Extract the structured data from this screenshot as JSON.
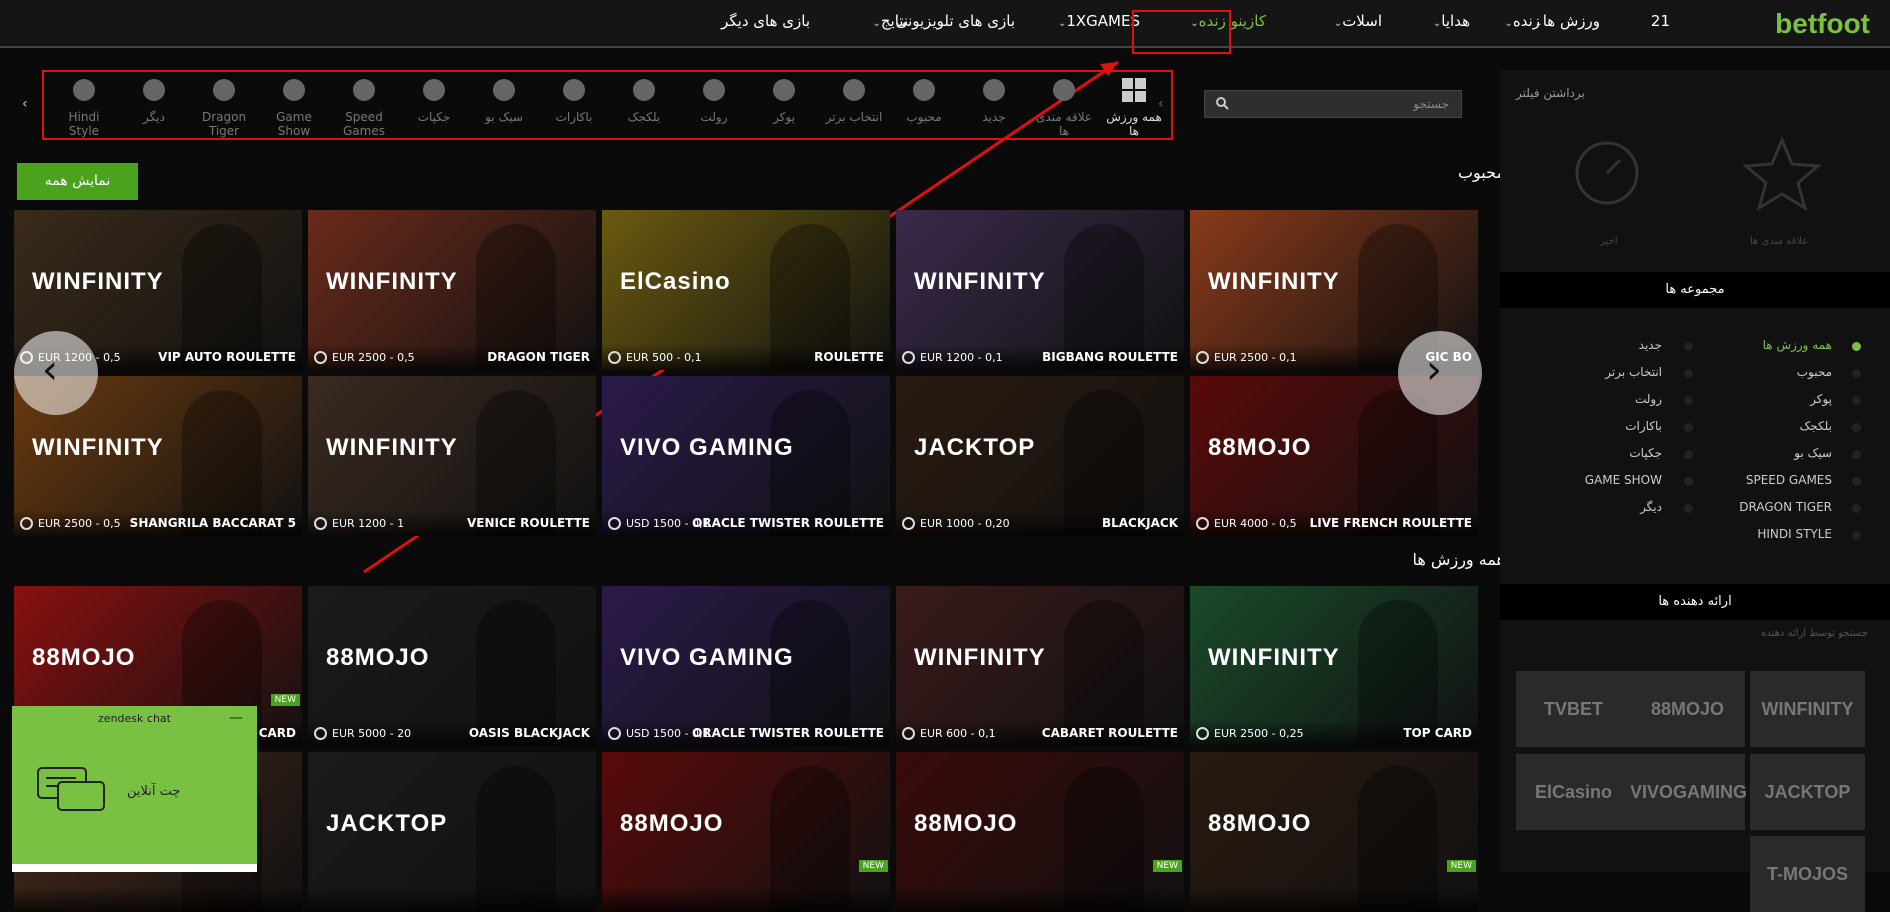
{
  "brand": {
    "logo": "betfoot",
    "logo_color": "#7cc043",
    "accent": "#4aa21d",
    "annotation_color": "#e01010"
  },
  "nav": {
    "items": [
      {
        "label": "21",
        "icon": "dice-21-icon"
      },
      {
        "label": "ورزش ها",
        "dropdown": true
      },
      {
        "label": "زنده",
        "dropdown": true
      },
      {
        "label": "هدایا",
        "dropdown": true
      },
      {
        "label": "اسلات",
        "dropdown": true
      },
      {
        "label": "کازینو زنده",
        "dropdown": true,
        "active": true
      },
      {
        "label": "1XGAMES",
        "dropdown": true
      },
      {
        "label": "بازی های تلویزیونی",
        "dropdown": false
      },
      {
        "label": "نتایج",
        "dropdown": true
      },
      {
        "label": "بازی های دیگر",
        "dropdown": false
      }
    ]
  },
  "categories": [
    {
      "label": "همه ورزش ها",
      "icon": "grid-icon",
      "active": true
    },
    {
      "label": "علاقه مندی ها",
      "icon": "star-icon"
    },
    {
      "label": "جدید",
      "icon": "new-badge-icon"
    },
    {
      "label": "محبوب",
      "icon": "flame-icon"
    },
    {
      "label": "انتخاب برتر",
      "icon": "top-choice-icon"
    },
    {
      "label": "پوکر",
      "icon": "poker-icon"
    },
    {
      "label": "رولت",
      "icon": "roulette-icon"
    },
    {
      "label": "بلکجک",
      "icon": "blackjack-icon"
    },
    {
      "label": "باکارات",
      "icon": "baccarat-icon"
    },
    {
      "label": "سیک بو",
      "icon": "dice-icon"
    },
    {
      "label": "جکپات",
      "icon": "moneybag-icon"
    },
    {
      "label": "Speed Games",
      "icon": "speedometer-icon"
    },
    {
      "label": "Game Show",
      "icon": "wheel-icon"
    },
    {
      "label": "Dragon Tiger",
      "icon": "dragon-icon"
    },
    {
      "label": "دیگر",
      "icon": "chips-icon"
    },
    {
      "label": "Hindi Style",
      "icon": "lotus-icon"
    }
  ],
  "search": {
    "placeholder": "جستجو"
  },
  "popular": {
    "title": "محبوب",
    "show_all": "نمایش همه",
    "games": [
      {
        "name": "GIC BO",
        "limit": "EUR 2500 - 0,1",
        "brand": "WINFINITY",
        "color": "#8a3a1a"
      },
      {
        "name": "BIGBANG ROULETTE",
        "limit": "EUR 1200 - 0,1",
        "brand": "WINFINITY",
        "color": "#3a2a4a"
      },
      {
        "name": "ROULETTE",
        "limit": "EUR 500 - 0,1",
        "brand": "ElCasino",
        "color": "#6a5a10"
      },
      {
        "name": "DRAGON TIGER",
        "limit": "EUR 2500 - 0,5",
        "brand": "WINFINITY",
        "color": "#6a2a1a"
      },
      {
        "name": "VIP AUTO ROULETTE",
        "limit": "EUR 1200 - 0,5",
        "brand": "WINFINITY",
        "color": "#3a2a1a"
      },
      {
        "name": "LIVE FRENCH ROULETTE",
        "limit": "EUR 4000 - 0,5",
        "brand": "88MOJO",
        "color": "#5a0a0a"
      },
      {
        "name": "BLACKJACK",
        "limit": "EUR 1000 - 0,20",
        "brand": "JACKTOP",
        "color": "#2a1a10"
      },
      {
        "name": "ORACLE TWISTER ROULETTE",
        "limit": "USD 1500 - 0,1",
        "brand": "VIVO GAMING",
        "color": "#2a1a4a"
      },
      {
        "name": "VENICE ROULETTE",
        "limit": "EUR 1200 - 1",
        "brand": "WINFINITY",
        "color": "#3a2a20"
      },
      {
        "name": "SHANGRILA BACCARAT 5",
        "limit": "EUR 2500 - 0,5",
        "brand": "WINFINITY",
        "color": "#6a3a10"
      }
    ]
  },
  "all": {
    "title": "همه ورزش ها",
    "games": [
      {
        "name": "TOP CARD",
        "limit": "EUR 2500 - 0,25",
        "brand": "WINFINITY",
        "color": "#1a4a2a"
      },
      {
        "name": "CABARET ROULETTE",
        "limit": "EUR 600 - 0,1",
        "brand": "WINFINITY",
        "color": "#3a1a1a"
      },
      {
        "name": "ORACLE TWISTER ROULETTE",
        "limit": "USD 1500 - 0,1",
        "brand": "VIVO GAMING",
        "color": "#2a1a4a"
      },
      {
        "name": "OASIS BLACKJACK",
        "limit": "EUR 5000 - 20",
        "brand": "88MOJO",
        "color": "#1a1a1a"
      },
      {
        "name": "P CARD",
        "limit": "",
        "brand": "88MOJO",
        "color": "#8a1010",
        "new": "NEW"
      },
      {
        "name": "",
        "limit": "",
        "brand": "88MOJO",
        "color": "#2a1a10",
        "new": "NEW"
      },
      {
        "name": "",
        "limit": "",
        "brand": "88MOJO",
        "color": "#3a0a0a",
        "new": "NEW"
      },
      {
        "name": "",
        "limit": "",
        "brand": "88MOJO",
        "color": "#5a0a0a",
        "new": "NEW"
      },
      {
        "name": "",
        "limit": "",
        "brand": "JACKTOP",
        "color": "#1a1a1a"
      },
      {
        "name": "",
        "limit": "",
        "brand": "",
        "color": "#4a2a1a"
      }
    ]
  },
  "sidebar": {
    "remove_filter": "برداشتن فیلتر",
    "favorites": "علاقه مندی ها",
    "recent": "اخیر",
    "collections_title": "مجموعه ها",
    "collections_right": [
      "همه ورزش ها",
      "محبوب",
      "پوکر",
      "بلکجک",
      "سیک بو",
      "SPEED GAMES",
      "DRAGON TIGER",
      "HINDI STYLE"
    ],
    "collections_left": [
      "جدید",
      "انتخاب برتر",
      "رولت",
      "باکارات",
      "جکپات",
      "GAME SHOW",
      "دیگر"
    ],
    "providers_title": "ارائه دهنده ها",
    "providers_search": "جستجو توسط ارائه دهنده",
    "providers": [
      "WINFINITY",
      "88MOJO",
      "TVBET",
      "JACKTOP",
      "VIVOGAMING",
      "ElCasino",
      "T-MOJOS"
    ]
  },
  "chat": {
    "title": "zendesk chat",
    "message": "چت آنلاین"
  }
}
